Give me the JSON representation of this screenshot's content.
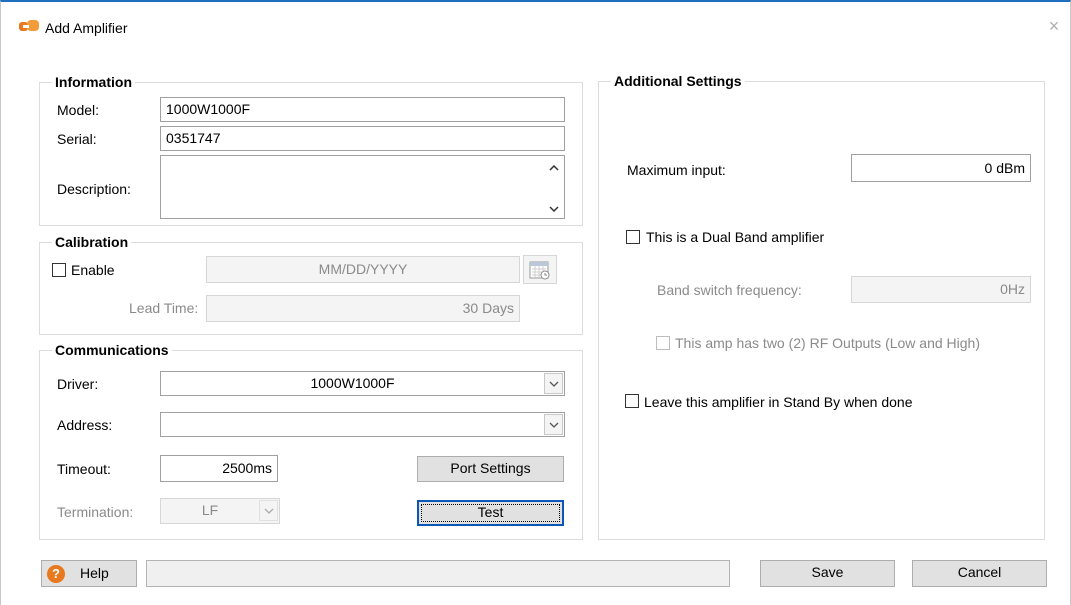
{
  "window": {
    "title": "Add Amplifier",
    "close_glyph": "×",
    "accent_color": "#1e6fbf",
    "icon": "app-logo-icon"
  },
  "information": {
    "title": "Information",
    "model_label": "Model:",
    "model_value": "1000W1000F",
    "serial_label": "Serial:",
    "serial_value": "0351747",
    "description_label": "Description:",
    "description_value": ""
  },
  "calibration": {
    "title": "Calibration",
    "enable_label": "Enable",
    "enable_checked": false,
    "date_placeholder": "MM/DD/YYYY",
    "lead_time_label": "Lead Time:",
    "lead_time_value": "30 Days"
  },
  "communications": {
    "title": "Communications",
    "driver_label": "Driver:",
    "driver_value": "1000W1000F",
    "address_label": "Address:",
    "address_value": "",
    "timeout_label": "Timeout:",
    "timeout_value": "2500ms",
    "port_settings_label": "Port Settings",
    "termination_label": "Termination:",
    "termination_value": "LF",
    "test_label": "Test"
  },
  "additional": {
    "title": "Additional Settings",
    "max_input_label": "Maximum input:",
    "max_input_value": "0 dBm",
    "dual_band_label": "This is a Dual Band amplifier",
    "dual_band_checked": false,
    "band_switch_label": "Band switch frequency:",
    "band_switch_value": "0Hz",
    "two_outputs_label": "This amp has two (2) RF Outputs (Low and High)",
    "standby_label": "Leave this amplifier in Stand By when done",
    "standby_checked": false
  },
  "footer": {
    "help_label": "Help",
    "help_icon_glyph": "?",
    "status_text": "",
    "save_label": "Save",
    "cancel_label": "Cancel"
  }
}
